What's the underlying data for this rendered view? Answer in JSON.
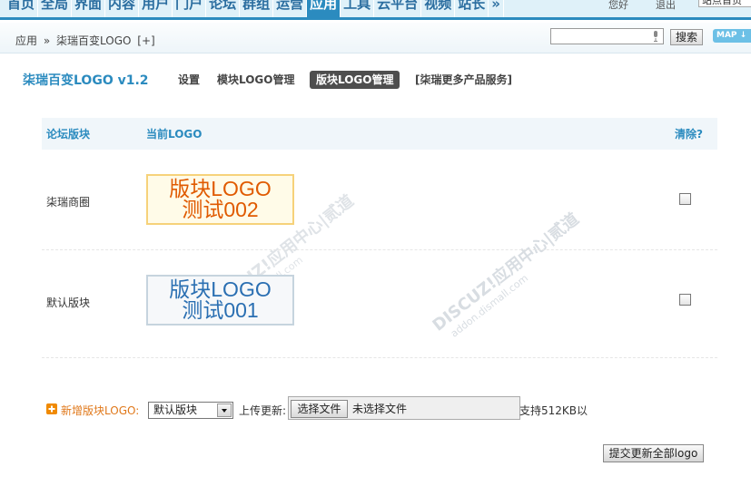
{
  "nav": {
    "items": [
      "首页",
      "全局",
      "界面",
      "内容",
      "用户",
      "门户",
      "论坛",
      "群组",
      "运营",
      "应用",
      "工具",
      "云平台",
      "视频",
      "站长",
      "»"
    ],
    "active_index": 9,
    "right_text_1": "您好",
    "right_text_2": "退出",
    "mini_input_value": "站点首页"
  },
  "breadcrumb": {
    "root": "应用",
    "sep": "»",
    "current": "柒瑞百变LOGO",
    "add": "[+]"
  },
  "search": {
    "button": "搜索",
    "map": "MAP ↓"
  },
  "plugin": {
    "title": "柒瑞百变LOGO v1.2",
    "tabs": [
      "设置",
      "模块LOGO管理",
      "版块LOGO管理",
      "[柒瑞更多产品服务]"
    ],
    "active_tab": 2
  },
  "table": {
    "headers": {
      "forum": "论坛版块",
      "logo": "当前LOGO",
      "clear": "清除?"
    },
    "rows": [
      {
        "forum": "柒瑞商圈",
        "logo_line1": "版块LOGO",
        "logo_line2": "测试002"
      },
      {
        "forum": "默认版块",
        "logo_line1": "版块LOGO",
        "logo_line2": "测试001"
      }
    ]
  },
  "watermark": {
    "main": "DISCUZ!应用中心|贰道",
    "sub": "addon.dismall.com"
  },
  "form": {
    "new_label": "新增版块LOGO:",
    "select_value": "默认版块",
    "upload_label": "上传更新:",
    "file_button": "选择文件",
    "file_status": "未选择文件",
    "support_text": "支持512KB以",
    "submit": "提交更新全部logo"
  },
  "colors": {
    "accent": "#2b8bbf",
    "orange": "#e05a00",
    "logo_blue": "#2a6fb2"
  }
}
